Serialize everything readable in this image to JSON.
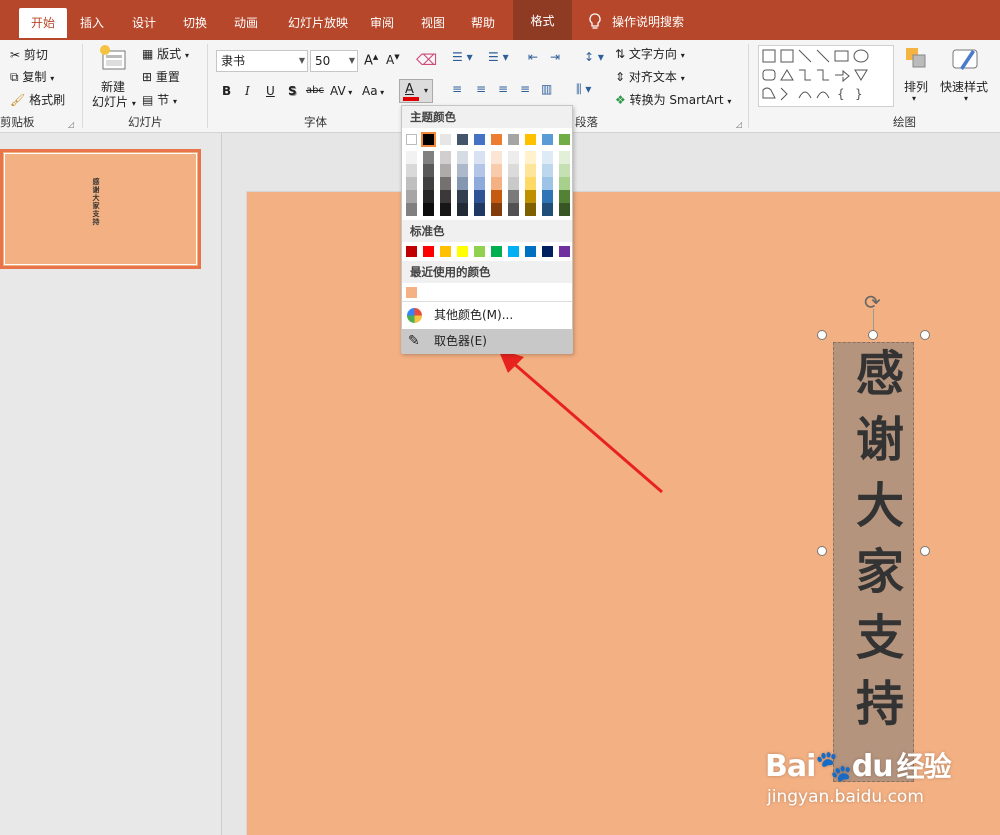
{
  "tabs": [
    {
      "label": "开始",
      "active": true
    },
    {
      "label": "插入"
    },
    {
      "label": "设计"
    },
    {
      "label": "切换"
    },
    {
      "label": "动画"
    },
    {
      "label": "幻灯片放映"
    },
    {
      "label": "审阅"
    },
    {
      "label": "视图"
    },
    {
      "label": "帮助"
    },
    {
      "label": "格式",
      "contextual": true
    }
  ],
  "tell_me": "操作说明搜索",
  "clipboard": {
    "cut": "剪切",
    "copy": "复制",
    "format_painter": "格式刷",
    "group_label": "剪贴板"
  },
  "slides_group": {
    "new_slide_line1": "新建",
    "new_slide_line2": "幻灯片",
    "layout": "版式",
    "reset": "重置",
    "section": "节",
    "group_label": "幻灯片"
  },
  "font": {
    "name": "隶书",
    "size": "50",
    "group_label": "字体",
    "buttons": [
      "B",
      "I",
      "U",
      "S",
      "abc",
      "AV",
      "Aa",
      "A"
    ]
  },
  "paragraph": {
    "text_direction": "文字方向",
    "align_text": "对齐文本",
    "convert_smartart": "转换为 SmartArt",
    "group_label": "段落"
  },
  "drawing": {
    "arrange": "排列",
    "quick_styles": "快速样式",
    "group_label": "绘图"
  },
  "slide_text": [
    "感",
    "谢",
    "大",
    "家",
    "支",
    "持"
  ],
  "thumbnail_text": "感谢大家支持",
  "color_menu": {
    "theme_title": "主题颜色",
    "theme_colors": [
      "#ffffff",
      "#000000",
      "#e7e6e6",
      "#44546a",
      "#4472c4",
      "#ed7d31",
      "#a5a5a5",
      "#ffc000",
      "#5b9bd5",
      "#70ad47"
    ],
    "shade_columns": [
      [
        "#f2f2f2",
        "#d9d9d9",
        "#bfbfbf",
        "#a6a6a6",
        "#808080"
      ],
      [
        "#808080",
        "#595959",
        "#404040",
        "#262626",
        "#0d0d0d"
      ],
      [
        "#d0cece",
        "#aeabab",
        "#757171",
        "#3a3838",
        "#171616"
      ],
      [
        "#d6dce4",
        "#adb9ca",
        "#8497b0",
        "#333f4f",
        "#222a35"
      ],
      [
        "#d9e2f3",
        "#b4c6e7",
        "#8eaadb",
        "#2f5496",
        "#1f3864"
      ],
      [
        "#fbe5d5",
        "#f7cbac",
        "#f4b183",
        "#c55a11",
        "#833c0b"
      ],
      [
        "#ededed",
        "#dbdbdb",
        "#c9c9c9",
        "#7b7b7b",
        "#525252"
      ],
      [
        "#fff2cc",
        "#fee599",
        "#ffd965",
        "#bf9000",
        "#7f6000"
      ],
      [
        "#deebf6",
        "#bdd7ee",
        "#9dc3e6",
        "#2e75b5",
        "#1f4e79"
      ],
      [
        "#e2efd9",
        "#c5e0b3",
        "#a8d08d",
        "#538135",
        "#375623"
      ]
    ],
    "standard_title": "标准色",
    "standard_colors": [
      "#c00000",
      "#ff0000",
      "#ffc000",
      "#ffff00",
      "#92d050",
      "#00b050",
      "#00b0f0",
      "#0070c0",
      "#002060",
      "#7030a0"
    ],
    "recent_title": "最近使用的颜色",
    "recent_colors": [
      "#f4b183"
    ],
    "more_colors": "其他颜色(M)...",
    "eyedropper": "取色器(E)"
  },
  "watermark": {
    "brand": "Bai",
    "brand2": "du",
    "suffix": "经验",
    "url": "jingyan.baidu.com"
  },
  "colors": {
    "accent": "#b7472a",
    "slide_bg": "#f3b083",
    "textbox_bg": "#b5947e",
    "arrow": "#e8231f"
  }
}
